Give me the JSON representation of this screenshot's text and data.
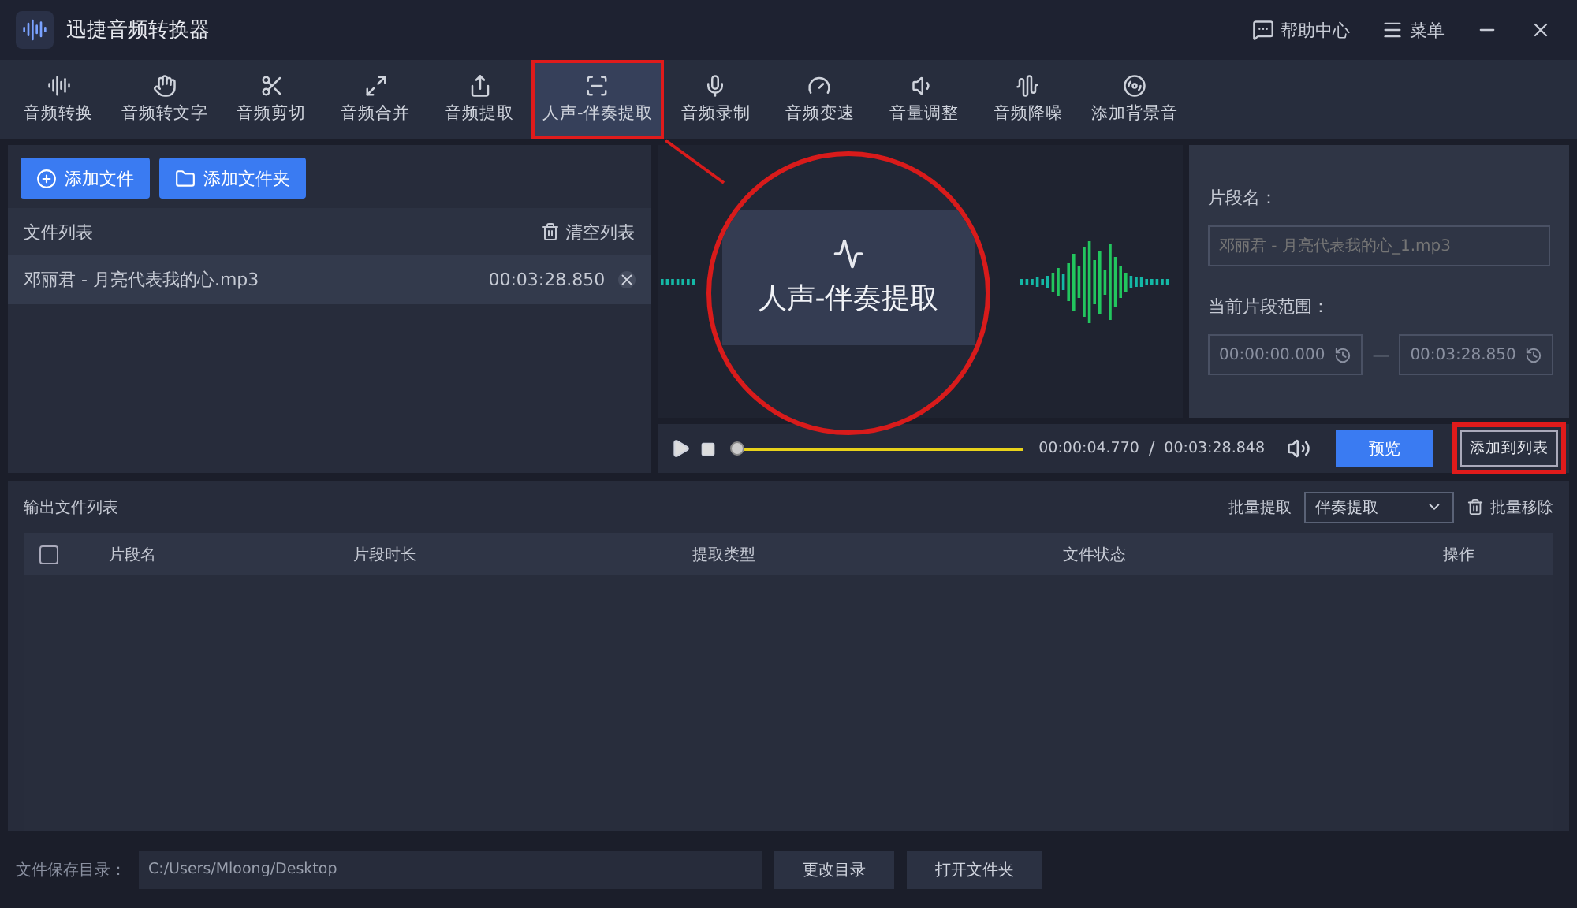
{
  "app": {
    "title": "迅捷音频转换器",
    "help": "帮助中心",
    "menu": "菜单"
  },
  "tabs": [
    {
      "label": "音频转换",
      "selected": false,
      "highlighted": false
    },
    {
      "label": "音频转文字",
      "selected": false,
      "highlighted": false
    },
    {
      "label": "音频剪切",
      "selected": false,
      "highlighted": false
    },
    {
      "label": "音频合并",
      "selected": false,
      "highlighted": false
    },
    {
      "label": "音频提取",
      "selected": false,
      "highlighted": false
    },
    {
      "label": "人声-伴奏提取",
      "selected": true,
      "highlighted": true
    },
    {
      "label": "音频录制",
      "selected": false,
      "highlighted": false
    },
    {
      "label": "音频变速",
      "selected": false,
      "highlighted": false
    },
    {
      "label": "音量调整",
      "selected": false,
      "highlighted": false
    },
    {
      "label": "音频降噪",
      "selected": false,
      "highlighted": false
    },
    {
      "label": "添加背景音",
      "selected": false,
      "highlighted": false
    }
  ],
  "file_panel": {
    "add_file": "添加文件",
    "add_folder": "添加文件夹",
    "list_title": "文件列表",
    "clear": "清空列表",
    "files": [
      {
        "name": "邓丽君 - 月亮代表我的心.mp3",
        "duration": "00:03:28.850",
        "selected": true
      }
    ]
  },
  "segment": {
    "name_label": "片段名：",
    "name_placeholder": "邓丽君 - 月亮代表我的心_1.mp3",
    "range_label": "当前片段范围：",
    "start": "00:00:00.000",
    "range_separator": "—",
    "end": "00:03:28.850"
  },
  "player": {
    "current": "00:00:04.770",
    "separator": "/",
    "total": "00:03:28.848",
    "level": 0.02,
    "preview": "预览",
    "add": {
      "label": "添加到列表",
      "highlighted": true
    }
  },
  "output": {
    "title": "输出文件列表",
    "batch_label": "批量提取",
    "batch_value": "伴奏提取",
    "remove": "批量移除",
    "all_checked": false,
    "columns": [
      "片段名",
      "片段时长",
      "提取类型",
      "文件状态",
      "操作"
    ]
  },
  "footer": {
    "label": "文件保存目录：",
    "path": "C:/Users/Mloong/Desktop",
    "change": "更改目录",
    "open": "打开文件夹"
  },
  "callout": {
    "label": "人声-伴奏提取"
  }
}
